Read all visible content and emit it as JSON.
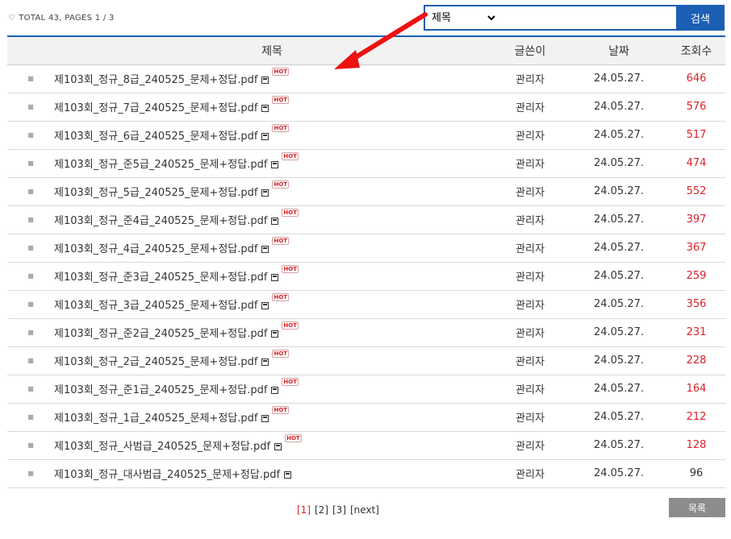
{
  "header": {
    "total_text": "TOTAL 43,   PAGES 1 / 3",
    "icon": "lightbulb-icon"
  },
  "search": {
    "field_value": "제목",
    "field_options": [
      "제목"
    ],
    "query": "",
    "button_label": "검색"
  },
  "table": {
    "columns": {
      "title": "제목",
      "writer": "글쓴이",
      "date": "날짜",
      "views": "조회수"
    },
    "rows": [
      {
        "title": "제103회_정규_8급_240525_문제+정답.pdf",
        "writer": "관리자",
        "date": "24.05.27.",
        "views": "646",
        "hot": true
      },
      {
        "title": "제103회_정규_7급_240525_문제+정답.pdf",
        "writer": "관리자",
        "date": "24.05.27.",
        "views": "576",
        "hot": true
      },
      {
        "title": "제103회_정규_6급_240525_문제+정답.pdf",
        "writer": "관리자",
        "date": "24.05.27.",
        "views": "517",
        "hot": true
      },
      {
        "title": "제103회_정규_준5급_240525_문제+정답.pdf",
        "writer": "관리자",
        "date": "24.05.27.",
        "views": "474",
        "hot": true
      },
      {
        "title": "제103회_정규_5급_240525_문제+정답.pdf",
        "writer": "관리자",
        "date": "24.05.27.",
        "views": "552",
        "hot": true
      },
      {
        "title": "제103회_정규_준4급_240525_문제+정답.pdf",
        "writer": "관리자",
        "date": "24.05.27.",
        "views": "397",
        "hot": true
      },
      {
        "title": "제103회_정규_4급_240525_문제+정답.pdf",
        "writer": "관리자",
        "date": "24.05.27.",
        "views": "367",
        "hot": true
      },
      {
        "title": "제103회_정규_준3급_240525_문제+정답.pdf",
        "writer": "관리자",
        "date": "24.05.27.",
        "views": "259",
        "hot": true
      },
      {
        "title": "제103회_정규_3급_240525_문제+정답.pdf",
        "writer": "관리자",
        "date": "24.05.27.",
        "views": "356",
        "hot": true
      },
      {
        "title": "제103회_정규_준2급_240525_문제+정답.pdf",
        "writer": "관리자",
        "date": "24.05.27.",
        "views": "231",
        "hot": true
      },
      {
        "title": "제103회_정규_2급_240525_문제+정답.pdf",
        "writer": "관리자",
        "date": "24.05.27.",
        "views": "228",
        "hot": true
      },
      {
        "title": "제103회_정규_준1급_240525_문제+정답.pdf",
        "writer": "관리자",
        "date": "24.05.27.",
        "views": "164",
        "hot": true
      },
      {
        "title": "제103회_정규_1급_240525_문제+정답.pdf",
        "writer": "관리자",
        "date": "24.05.27.",
        "views": "212",
        "hot": true
      },
      {
        "title": "제103회_정규_사범급_240525_문제+정답.pdf",
        "writer": "관리자",
        "date": "24.05.27.",
        "views": "128",
        "hot": true
      },
      {
        "title": "제103회_정규_대사범급_240525_문제+정답.pdf",
        "writer": "관리자",
        "date": "24.05.27.",
        "views": "96",
        "hot": false
      }
    ],
    "hot_badge_text": "HOT",
    "hot_color": "#d8222a"
  },
  "pagination": {
    "pages": [
      "[1]",
      "[2]",
      "[3]"
    ],
    "current_index": 0,
    "next_label": "[next]"
  },
  "list_button": {
    "label": "목록"
  },
  "colors": {
    "accent": "#1c5fb4",
    "annotation_arrow": "#ee1111"
  }
}
